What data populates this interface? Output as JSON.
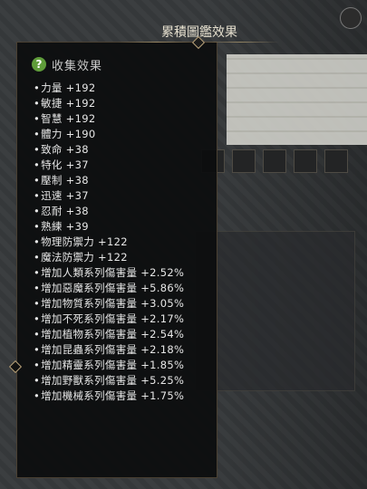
{
  "window": {
    "title": "累積圖鑑效果"
  },
  "section": {
    "icon": "help-icon",
    "icon_glyph": "?",
    "label": "收集效果"
  },
  "stats": [
    "力量 +192",
    "敏捷 +192",
    "智慧 +192",
    "體力 +190",
    "致命 +38",
    "特化 +37",
    "壓制 +38",
    "迅速 +37",
    "忍耐 +38",
    "熟練 +39",
    "物理防禦力 +122",
    "魔法防禦力 +122",
    "增加人類系列傷害量 +2.52%",
    "增加惡魔系列傷害量 +5.86%",
    "增加物質系列傷害量 +3.05%",
    "增加不死系列傷害量 +2.17%",
    "增加植物系列傷害量 +2.54%",
    "增加昆蟲系列傷害量 +2.18%",
    "增加精靈系列傷害量 +1.85%",
    "增加野獸系列傷害量 +5.25%",
    "增加機械系列傷害量 +1.75%"
  ],
  "bullet": "•",
  "colors": {
    "accent": "#b9a27a",
    "help_icon": "#5f9c3a",
    "text": "#e7e7e7"
  }
}
